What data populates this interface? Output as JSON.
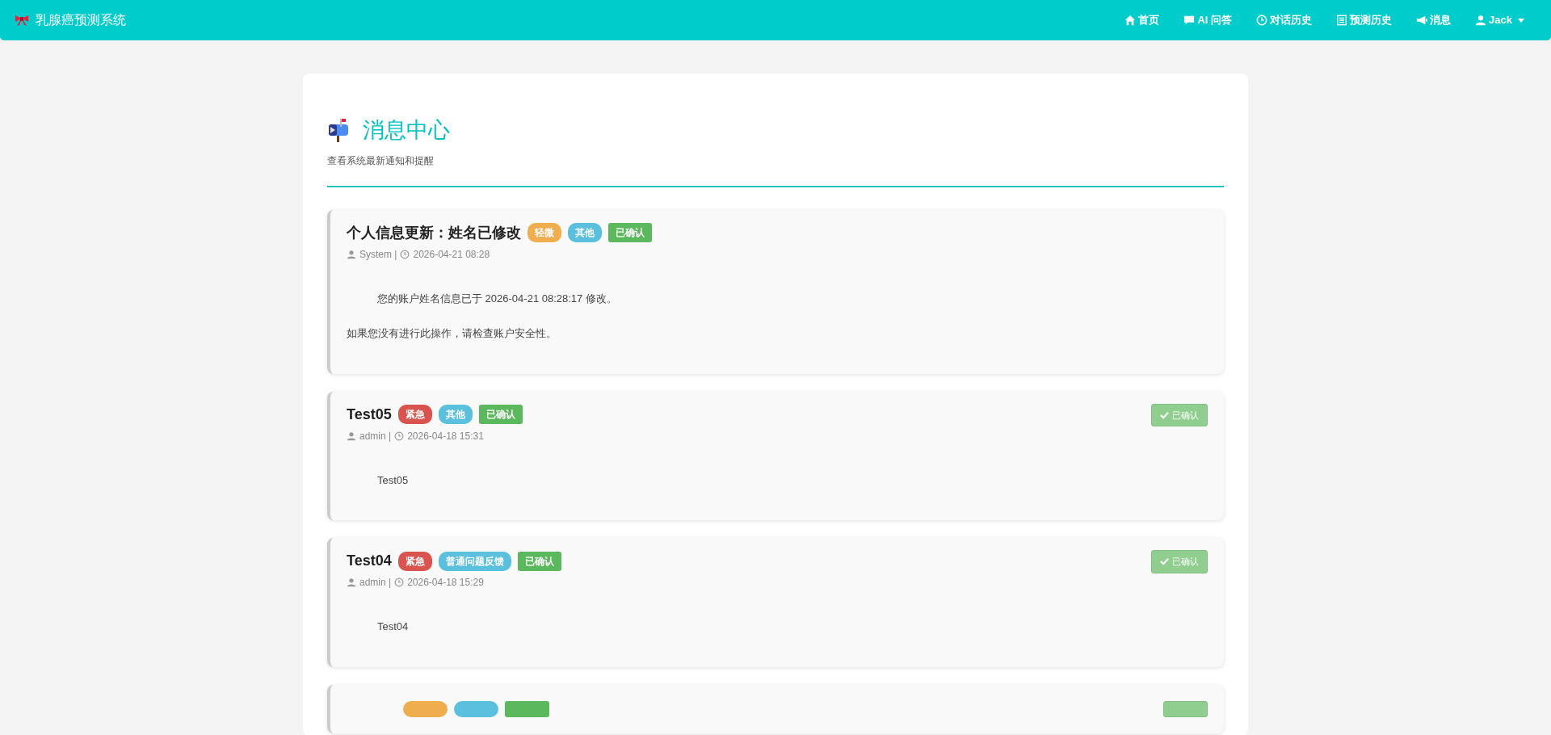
{
  "navbar": {
    "brand": "乳腺癌预测系统",
    "items": [
      {
        "kind": "home",
        "label": "首页"
      },
      {
        "kind": "chat",
        "label": "AI 问答"
      },
      {
        "kind": "clock",
        "label": "对话历史"
      },
      {
        "kind": "list",
        "label": "预测历史"
      },
      {
        "kind": "megaphone",
        "label": "消息"
      },
      {
        "kind": "user",
        "label": "Jack",
        "dropdown": true
      }
    ]
  },
  "header": {
    "title": "消息中心",
    "subtitle": "查看系统最新通知和提醒"
  },
  "messages": [
    {
      "title": "个人信息更新：姓名已修改",
      "badges": [
        {
          "text": "轻微",
          "color": "#f0ad4e",
          "kind": "pill"
        },
        {
          "text": "其他",
          "color": "#5bc0de",
          "kind": "pill"
        },
        {
          "text": "已确认",
          "color": "#5cb85c",
          "kind": "square"
        }
      ],
      "author": "System |",
      "time": "2026-04-21 08:28",
      "body": [
        "您的账户姓名信息已于 2026-04-21 08:28:17 修改。",
        "如果您没有进行此操作，请检查账户安全性。"
      ]
    },
    {
      "title": "Test05",
      "badges": [
        {
          "text": "紧急",
          "color": "#d9534f",
          "kind": "pill"
        },
        {
          "text": "其他",
          "color": "#5bc0de",
          "kind": "pill"
        },
        {
          "text": "已确认",
          "color": "#5cb85c",
          "kind": "square"
        }
      ],
      "author": "admin |",
      "time": "2026-04-18 15:31",
      "body": [
        "Test05"
      ],
      "confirm_button": {
        "label": "已确认",
        "disabled": true
      }
    },
    {
      "title": "Test04",
      "badges": [
        {
          "text": "紧急",
          "color": "#d9534f",
          "kind": "pill"
        },
        {
          "text": "普通问题反馈",
          "color": "#5bc0de",
          "kind": "pill"
        },
        {
          "text": "已确认",
          "color": "#5cb85c",
          "kind": "square"
        }
      ],
      "author": "admin |",
      "time": "2026-04-18 15:29",
      "body": [
        "Test04"
      ],
      "confirm_button": {
        "label": "已确认",
        "disabled": true
      }
    }
  ],
  "partial_card": {
    "badges": [
      {
        "color": "#f0ad4e"
      },
      {
        "color": "#5bc0de"
      },
      {
        "color": "#5cb85c"
      }
    ],
    "confirm_button": true
  }
}
